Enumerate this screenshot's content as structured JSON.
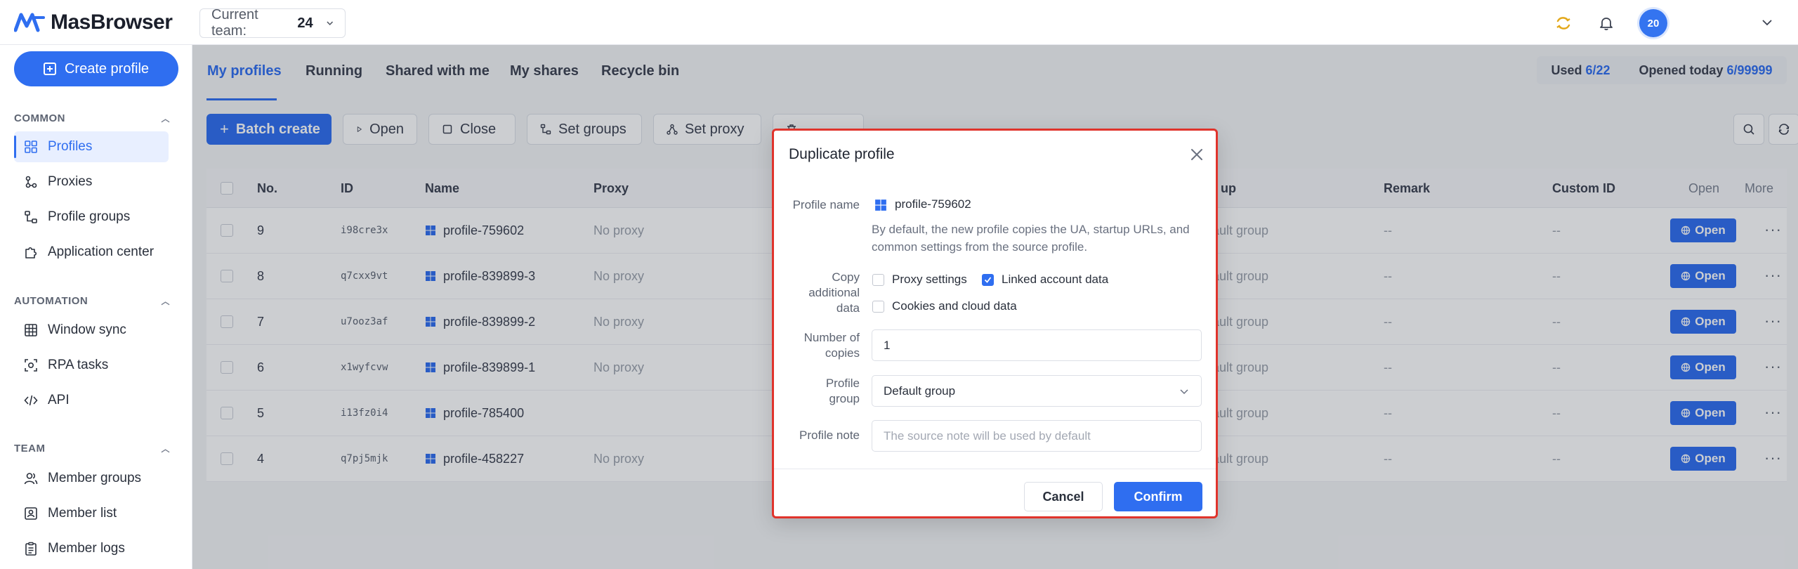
{
  "app": {
    "name": "MasBrowser"
  },
  "topbar": {
    "team_label": "Current team:",
    "team_value": "24",
    "avatar_text": "20"
  },
  "sidebar": {
    "create_label": "Create profile",
    "sections": [
      {
        "title": "COMMON",
        "items": [
          "Profiles",
          "Proxies",
          "Profile groups",
          "Application center"
        ]
      },
      {
        "title": "AUTOMATION",
        "items": [
          "Window sync",
          "RPA tasks",
          "API"
        ]
      },
      {
        "title": "TEAM",
        "items": [
          "Member groups",
          "Member list",
          "Member logs"
        ]
      }
    ],
    "active_item": "Profiles"
  },
  "tabs": [
    "My profiles",
    "Running",
    "Shared with me",
    "My shares",
    "Recycle bin"
  ],
  "usage": {
    "used_label": "Used",
    "used_value": "6/22",
    "opened_label": "Opened today",
    "opened_value": "6/99999"
  },
  "toolbar": {
    "batch_create": "Batch create",
    "open": "Open",
    "close": "Close",
    "set_groups": "Set groups",
    "set_proxy": "Set proxy"
  },
  "table": {
    "columns": {
      "no": "No.",
      "id": "ID",
      "name": "Name",
      "proxy": "Proxy",
      "group": "up",
      "remark": "Remark",
      "custom_id": "Custom ID",
      "open": "Open",
      "more": "More"
    },
    "rows": [
      {
        "no": "9",
        "id": "i98cre3x",
        "name": "profile-759602",
        "proxy": "No proxy",
        "group": "ault group",
        "remark": "--",
        "custom_id": "--",
        "open": "Open"
      },
      {
        "no": "8",
        "id": "q7cxx9vt",
        "name": "profile-839899-3",
        "proxy": "No proxy",
        "group": "ault group",
        "remark": "--",
        "custom_id": "--",
        "open": "Open"
      },
      {
        "no": "7",
        "id": "u7ooz3af",
        "name": "profile-839899-2",
        "proxy": "No proxy",
        "group": "ault group",
        "remark": "--",
        "custom_id": "--",
        "open": "Open"
      },
      {
        "no": "6",
        "id": "x1wyfcvw",
        "name": "profile-839899-1",
        "proxy": "No proxy",
        "group": "ault group",
        "remark": "--",
        "custom_id": "--",
        "open": "Open"
      },
      {
        "no": "5",
        "id": "i13fz0i4",
        "name": "profile-785400",
        "proxy": "",
        "group": "ault group",
        "remark": "--",
        "custom_id": "--",
        "open": "Open"
      },
      {
        "no": "4",
        "id": "q7pj5mjk",
        "name": "profile-458227",
        "proxy": "No proxy",
        "group": "ault group",
        "remark": "--",
        "custom_id": "--",
        "open": "Open"
      }
    ]
  },
  "modal": {
    "title": "Duplicate profile",
    "profile_name_label": "Profile name",
    "profile_name_value": "profile-759602",
    "help_text": "By default, the new profile copies the UA, startup URLs, and common settings from the source profile.",
    "copy_label_1": "Copy",
    "copy_label_2": "additional",
    "copy_label_3": "data",
    "option_proxy": "Proxy settings",
    "option_linked": "Linked account data",
    "option_cookies": "Cookies and cloud data",
    "copies_label_1": "Number of",
    "copies_label_2": "copies",
    "copies_value": "1",
    "group_label_1": "Profile",
    "group_label_2": "group",
    "group_value": "Default group",
    "note_label": "Profile note",
    "note_placeholder": "The source note will be used by default",
    "cancel": "Cancel",
    "confirm": "Confirm"
  },
  "colors": {
    "accent": "#2f6ef0",
    "highlight_border": "#e0342c"
  }
}
